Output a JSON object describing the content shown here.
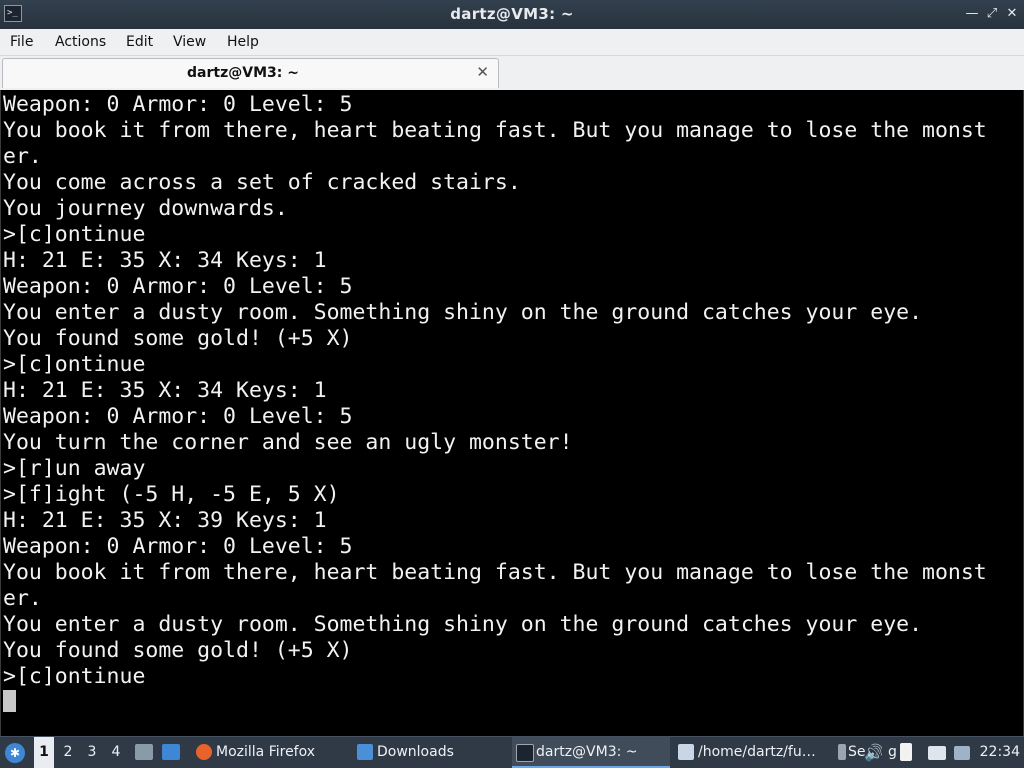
{
  "window": {
    "title": "dartz@VM3: ~",
    "app_icon": ">_",
    "minimize": "—",
    "maximize": "⤢",
    "close": "✕"
  },
  "menu": [
    "File",
    "Actions",
    "Edit",
    "View",
    "Help"
  ],
  "tab": {
    "label": "dartz@VM3: ~",
    "close": "✕"
  },
  "terminal": {
    "lines": [
      "Weapon: 0 Armor: 0 Level: 5",
      "You book it from there, heart beating fast. But you manage to lose the monst",
      "er.",
      "You come across a set of cracked stairs.",
      "You journey downwards.",
      ">[c]ontinue",
      "H: 21 E: 35 X: 34 Keys: 1",
      "Weapon: 0 Armor: 0 Level: 5",
      "You enter a dusty room. Something shiny on the ground catches your eye.",
      "You found some gold! (+5 X)",
      ">[c]ontinue",
      "H: 21 E: 35 X: 34 Keys: 1",
      "Weapon: 0 Armor: 0 Level: 5",
      "You turn the corner and see an ugly monster!",
      ">[r]un away",
      ">[f]ight (-5 H, -5 E, 5 X)",
      "H: 21 E: 35 X: 39 Keys: 1",
      "Weapon: 0 Armor: 0 Level: 5",
      "You book it from there, heart beating fast. But you manage to lose the monst",
      "er.",
      "You enter a dusty room. Something shiny on the ground catches your eye.",
      "You found some gold! (+5 X)",
      ">[c]ontinue"
    ]
  },
  "taskbar": {
    "workspaces": [
      "1",
      "2",
      "3",
      "4"
    ],
    "active_workspace": "1",
    "tasks": {
      "firefox": "Mozilla Firefox",
      "downloads": "Downloads",
      "terminal": "dartz@VM3: ~",
      "editor": "/home/dartz/fu…",
      "extra": "Se"
    },
    "tray_g": "g",
    "clock": "22:34",
    "colors": {
      "firefox": "#e8632b",
      "folder": "#4a90d9",
      "terminal": "#1c2430",
      "editor": "#c9d6e6"
    }
  }
}
